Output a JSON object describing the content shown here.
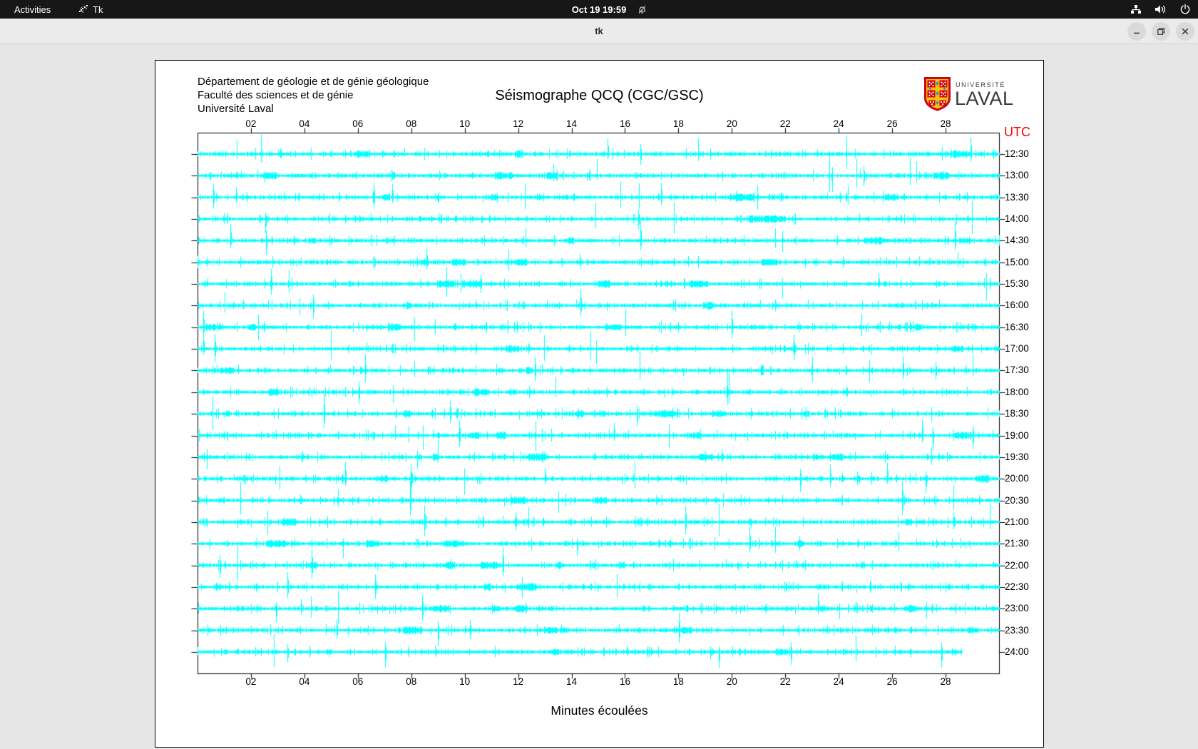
{
  "topbar": {
    "activities_label": "Activities",
    "app_label": "Tk",
    "clock": "Oct 19 19:59"
  },
  "window": {
    "title": "tk"
  },
  "header": {
    "address_lines": [
      "Département de géologie et de génie géologique",
      "Faculté des sciences et de génie",
      "Université Laval"
    ],
    "title": "Séismographe QCQ (CGC/GSC)",
    "logo": {
      "top": "UNIVERSITÉ",
      "bottom": "LAVAL"
    }
  },
  "chart_data": {
    "type": "line",
    "subtype": "seismograph-helicorder",
    "title": "Séismographe QCQ (CGC/GSC)",
    "xlabel": "Minutes écoulées",
    "right_axis_label": "UTC",
    "x_axis": {
      "min": 0,
      "max": 30,
      "tick_labels": [
        "02",
        "04",
        "06",
        "08",
        "10",
        "12",
        "14",
        "16",
        "18",
        "20",
        "22",
        "24",
        "26",
        "28"
      ]
    },
    "trace_color": "#00ffff",
    "traces": [
      {
        "label": "12:30",
        "end_fraction": 1
      },
      {
        "label": "13:00",
        "end_fraction": 1
      },
      {
        "label": "13:30",
        "end_fraction": 1
      },
      {
        "label": "14:00",
        "end_fraction": 1
      },
      {
        "label": "14:30",
        "end_fraction": 1
      },
      {
        "label": "15:00",
        "end_fraction": 1
      },
      {
        "label": "15:30",
        "end_fraction": 1
      },
      {
        "label": "16:00",
        "end_fraction": 1
      },
      {
        "label": "16:30",
        "end_fraction": 1
      },
      {
        "label": "17:00",
        "end_fraction": 1
      },
      {
        "label": "17:30",
        "end_fraction": 1
      },
      {
        "label": "18:00",
        "end_fraction": 1
      },
      {
        "label": "18:30",
        "end_fraction": 1
      },
      {
        "label": "19:00",
        "end_fraction": 1
      },
      {
        "label": "19:30",
        "end_fraction": 1
      },
      {
        "label": "20:00",
        "end_fraction": 1
      },
      {
        "label": "20:30",
        "end_fraction": 1
      },
      {
        "label": "21:00",
        "end_fraction": 1
      },
      {
        "label": "21:30",
        "end_fraction": 1
      },
      {
        "label": "22:00",
        "end_fraction": 1
      },
      {
        "label": "22:30",
        "end_fraction": 1
      },
      {
        "label": "23:00",
        "end_fraction": 1
      },
      {
        "label": "23:30",
        "end_fraction": 1
      },
      {
        "label": "24:00",
        "end_fraction": 0.954
      }
    ]
  },
  "colors": {
    "trace": "#00ffff",
    "utc_label": "#ff0000",
    "topbar_bg": "#171717",
    "titlebar_bg": "#ebebeb",
    "desktop_bg": "#e6e6e6"
  }
}
